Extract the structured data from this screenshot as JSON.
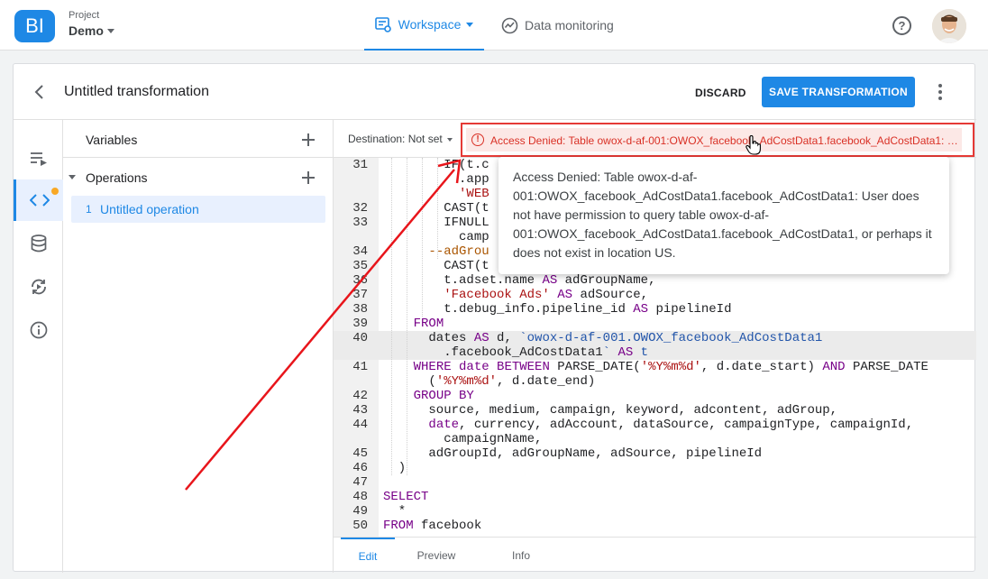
{
  "header": {
    "logo_text": "BI",
    "project_label": "Project",
    "project_name": "Demo",
    "nav_workspace": "Workspace",
    "nav_monitoring": "Data monitoring",
    "help_glyph": "?"
  },
  "card": {
    "title": "Untitled transformation",
    "discard_label": "DISCARD",
    "save_label": "SAVE TRANSFORMATION"
  },
  "left_panel": {
    "variables_label": "Variables",
    "operations_label": "Operations",
    "operations": [
      {
        "num": "1",
        "name": "Untitled operation"
      }
    ]
  },
  "editor": {
    "destination_label": "Destination: Not set",
    "error_icon": "!",
    "error_text": "Access Denied: Table owox-d-af-001:OWOX_facebook_AdCostData1.facebook_AdCostData1: User does not have permission to query table owox-d-af-001:OWOX_facebook_AdCostData1.facebook_AdCostData1, or perhaps it does not exist in location US.",
    "error_truncated": "Access Denied: Table owox-d-af-001:OWOX_facebook_AdCostData1.facebook_AdCostData1: U..."
  },
  "tooltip": {
    "text": "Access Denied: Table owox-d-af-001:OWOX_facebook_AdCostData1.facebook_AdCostData1: User does not have permission to query table owox-d-af-001:OWOX_facebook_AdCostData1.facebook_AdCostData1, or perhaps it does not exist in location US."
  },
  "code_lines": [
    {
      "n": "31",
      "t": "        IF(t.c"
    },
    {
      "n": "",
      "t": "          .app"
    },
    {
      "n": "",
      "t": "          'WEB"
    },
    {
      "n": "32",
      "t": "        CAST(t"
    },
    {
      "n": "33",
      "t": "        IFNULL"
    },
    {
      "n": "",
      "t": "          camp"
    },
    {
      "n": "34",
      "t": "      --adGrou"
    },
    {
      "n": "35",
      "t": "        CAST(t"
    },
    {
      "n": "36",
      "t": "        t.adset.name AS adGroupName,"
    },
    {
      "n": "37",
      "t": "        'Facebook Ads' AS adSource,"
    },
    {
      "n": "38",
      "t": "        t.debug_info.pipeline_id AS pipelineId"
    },
    {
      "n": "39",
      "t": "    FROM"
    },
    {
      "n": "40",
      "t": "      dates AS d, `owox-d-af-001.OWOX_facebook_AdCostData1"
    },
    {
      "n": "",
      "t": "        .facebook_AdCostData1` AS t"
    },
    {
      "n": "41",
      "t": "    WHERE date BETWEEN PARSE_DATE('%Y%m%d', d.date_start) AND PARSE_DATE"
    },
    {
      "n": "",
      "t": "      ('%Y%m%d', d.date_end)"
    },
    {
      "n": "42",
      "t": "    GROUP BY"
    },
    {
      "n": "43",
      "t": "      source, medium, campaign, keyword, adcontent, adGroup,"
    },
    {
      "n": "44",
      "t": "      date, currency, adAccount, dataSource, campaignType, campaignId,"
    },
    {
      "n": "",
      "t": "        campaignName,"
    },
    {
      "n": "45",
      "t": "      adGroupId, adGroupName, adSource, pipelineId"
    },
    {
      "n": "46",
      "t": "  )"
    },
    {
      "n": "47",
      "t": ""
    },
    {
      "n": "48",
      "t": "SELECT"
    },
    {
      "n": "49",
      "t": "  *"
    },
    {
      "n": "50",
      "t": "FROM facebook"
    }
  ],
  "tabs": {
    "edit": "Edit",
    "preview": "Preview",
    "info": "Info"
  },
  "icons": {
    "rail": [
      "queue-play-icon",
      "code-icon",
      "database-icon",
      "sync-play-icon",
      "info-icon"
    ]
  },
  "colors": {
    "accent": "#1e88e5",
    "error": "#d93025",
    "annotation": "#e8151b"
  }
}
